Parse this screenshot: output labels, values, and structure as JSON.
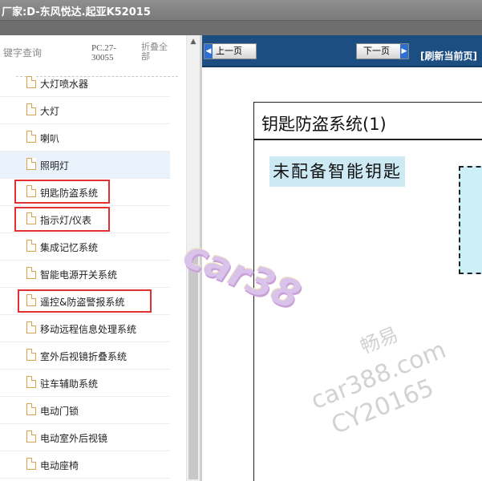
{
  "window": {
    "title": "厂家:D-东风悦达.起亚K52015"
  },
  "sidebar": {
    "search_label": "键字查询",
    "catalog_code": "PC.27-30055",
    "collapse_all": "折叠全部",
    "items": [
      {
        "label": "大灯喷水器",
        "highlighted": false
      },
      {
        "label": "大灯",
        "highlighted": false
      },
      {
        "label": "喇叭",
        "highlighted": false
      },
      {
        "label": "照明灯",
        "highlighted": true
      },
      {
        "label": "钥匙防盗系统",
        "highlighted": false
      },
      {
        "label": "指示灯/仪表",
        "highlighted": false
      },
      {
        "label": "集成记忆系统",
        "highlighted": false
      },
      {
        "label": "智能电源开关系统",
        "highlighted": false
      },
      {
        "label": "遥控&防盗警报系统",
        "highlighted": false
      },
      {
        "label": "移动远程信息处理系统",
        "highlighted": false
      },
      {
        "label": "室外后视镜折叠系统",
        "highlighted": false
      },
      {
        "label": "驻车辅助系统",
        "highlighted": false
      },
      {
        "label": "电动门锁",
        "highlighted": false
      },
      {
        "label": "电动室外后视镜",
        "highlighted": false
      },
      {
        "label": "电动座椅",
        "highlighted": false
      }
    ],
    "marked_items": [
      "钥匙防盗系统",
      "指示灯/仪表",
      "遥控&防盗警报系统"
    ]
  },
  "toolbar": {
    "prev_label": "上一页",
    "next_label": "下一页",
    "refresh_label": "[刷新当前页]"
  },
  "document": {
    "title": "钥匙防盗系统(1)",
    "callout": "未配备智能钥匙"
  },
  "watermark": {
    "brand": "car38",
    "cn": "畅易",
    "url": "car388.com",
    "code": "CY20165"
  },
  "colors": {
    "nav_bar": "#1d4e82",
    "highlight_row": "#eaf2fb",
    "annotation_box": "#e03030",
    "callout_bg": "#cde9f3"
  }
}
